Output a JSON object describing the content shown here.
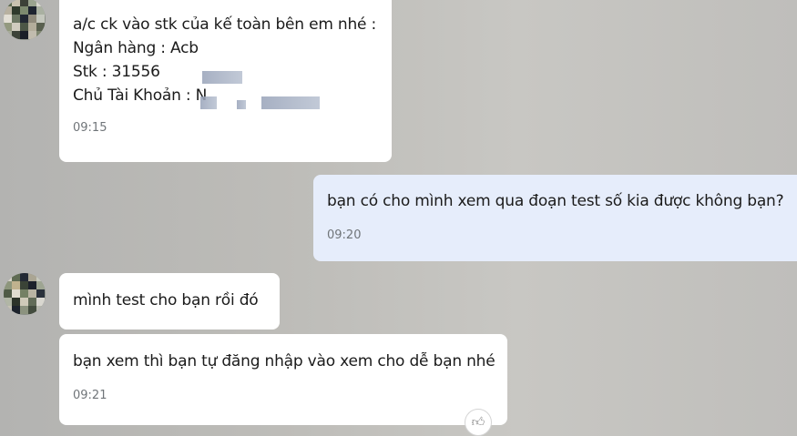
{
  "messages": [
    {
      "lines": [
        "a/c ck vào stk của kế toàn bên em nhé :",
        "Ngân hàng : Acb",
        "Stk : 31556",
        "Chủ Tài Khoản : N"
      ],
      "time": "09:15"
    },
    {
      "text": "bạn có cho mình xem qua đoạn test số kia được không bạn?",
      "time": "09:20"
    },
    {
      "text": "mình test cho bạn rồi đó"
    },
    {
      "text": "bạn xem thì bạn tự đăng nhập vào xem cho dễ bạn nhé",
      "time": "09:21"
    }
  ],
  "colors": {
    "outgoing_bubble": "#e6edfb",
    "incoming_bubble": "#ffffff",
    "timestamp": "#707579"
  },
  "icons": {
    "reaction": "like-icon"
  }
}
